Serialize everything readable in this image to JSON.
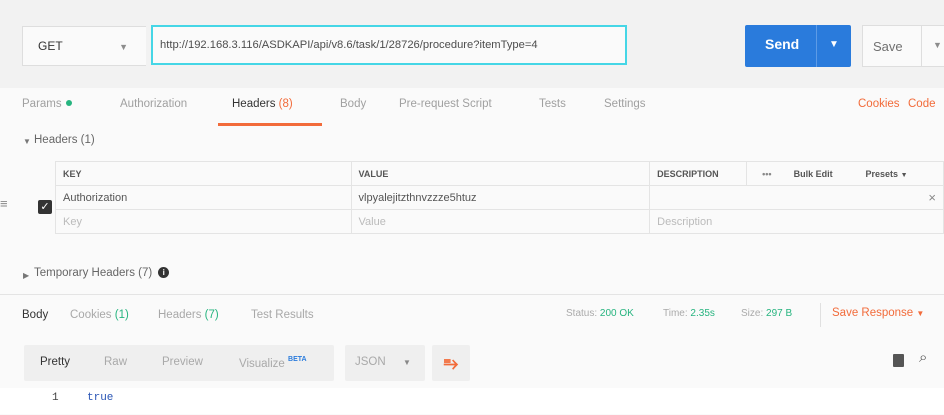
{
  "request": {
    "method": "GET",
    "url": "http://192.168.3.116/ASDKAPI/api/v8.6/task/1/28726/procedure?itemType=4",
    "send_label": "Send",
    "save_label": "Save"
  },
  "tabs": {
    "params": "Params",
    "authorization": "Authorization",
    "headers": "Headers",
    "headers_count": "(8)",
    "body": "Body",
    "prerequest": "Pre-request Script",
    "tests": "Tests",
    "settings": "Settings",
    "cookies": "Cookies",
    "code": "Code"
  },
  "headers_section": {
    "title": "Headers (1)",
    "columns": {
      "key": "KEY",
      "value": "VALUE",
      "description": "DESCRIPTION",
      "more": "•••",
      "bulk_edit": "Bulk Edit",
      "presets": "Presets"
    },
    "rows": [
      {
        "key": "Authorization",
        "value": "vlpyalejitzthnvzzze5htuz",
        "description": ""
      }
    ],
    "placeholder": {
      "key": "Key",
      "value": "Value",
      "description": "Description"
    },
    "temporary": "Temporary Headers (7)"
  },
  "response": {
    "tabs": {
      "body": "Body",
      "cookies": "Cookies",
      "cookies_count": "(1)",
      "headers": "Headers",
      "headers_count": "(7)",
      "tests": "Test Results"
    },
    "status_label": "Status:",
    "status": "200 OK",
    "time_label": "Time:",
    "time": "2.35s",
    "size_label": "Size:",
    "size": "297 B",
    "save_label": "Save Response",
    "formats": {
      "pretty": "Pretty",
      "raw": "Raw",
      "preview": "Preview",
      "visualize": "Visualize",
      "beta": "BETA"
    },
    "lang": "JSON",
    "lines": [
      {
        "n": "1",
        "text": "true"
      }
    ]
  },
  "colors": {
    "accent": "#f26b3a",
    "send": "#2a7bdc",
    "success": "#26b47f",
    "url_border": "#45d6e6"
  }
}
